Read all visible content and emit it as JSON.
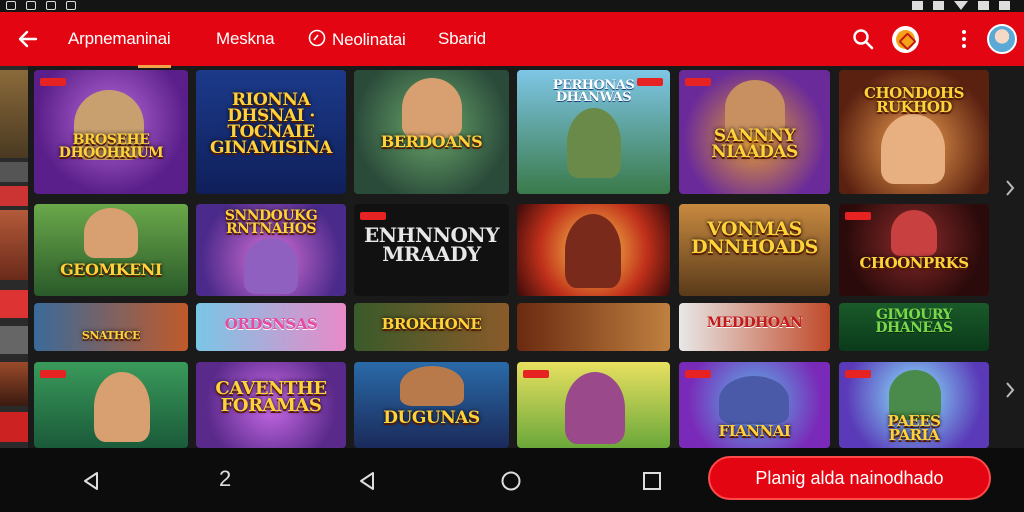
{
  "app_bar": {
    "tabs": [
      {
        "label": "Arpnemaninai"
      },
      {
        "label": "Meskna"
      },
      {
        "label": "Neolinatai"
      },
      {
        "label": "Sbarid"
      }
    ]
  },
  "games": {
    "row1": [
      {
        "title": "BROSEHE\nDHOOHRIUM"
      },
      {
        "title": "RIONNA\nDHSNAI · TOCNAIE\nGINAMISINA"
      },
      {
        "title": "BERDOANS"
      },
      {
        "title": "PERHONAS\nDHANWAS"
      },
      {
        "title": "SANNNY\nNIAADAS"
      },
      {
        "title": "CHONDOHS\nRUKHOD"
      }
    ],
    "row2": [
      {
        "title": "GEOMKENI"
      },
      {
        "title": "SNNDOUKG\nRNTNAHOS"
      },
      {
        "title": "ENHNNONY\nMRAADY"
      },
      {
        "title": ""
      },
      {
        "title": "VONMAS\nDNNHOADS"
      },
      {
        "title": "CHOONPRKS"
      }
    ],
    "row3": [
      {
        "title": "SNATHCE"
      },
      {
        "title": "ORDSNSAS"
      },
      {
        "title": "BROKHONE"
      },
      {
        "title": ""
      },
      {
        "title": "MEDDHOAN"
      },
      {
        "title": "GIMOURY\nDHANEAS"
      }
    ],
    "row4": [
      {
        "title": ""
      },
      {
        "title": "CAVENTHE\nFORAMAS"
      },
      {
        "title": "DUGUNAS"
      },
      {
        "title": ""
      },
      {
        "title": "FIANNAI"
      },
      {
        "title": "PAEES\nPARIA"
      }
    ]
  },
  "bottom_nav": {
    "number_label": "2",
    "cta_label": "Planig alda nainodhado"
  }
}
